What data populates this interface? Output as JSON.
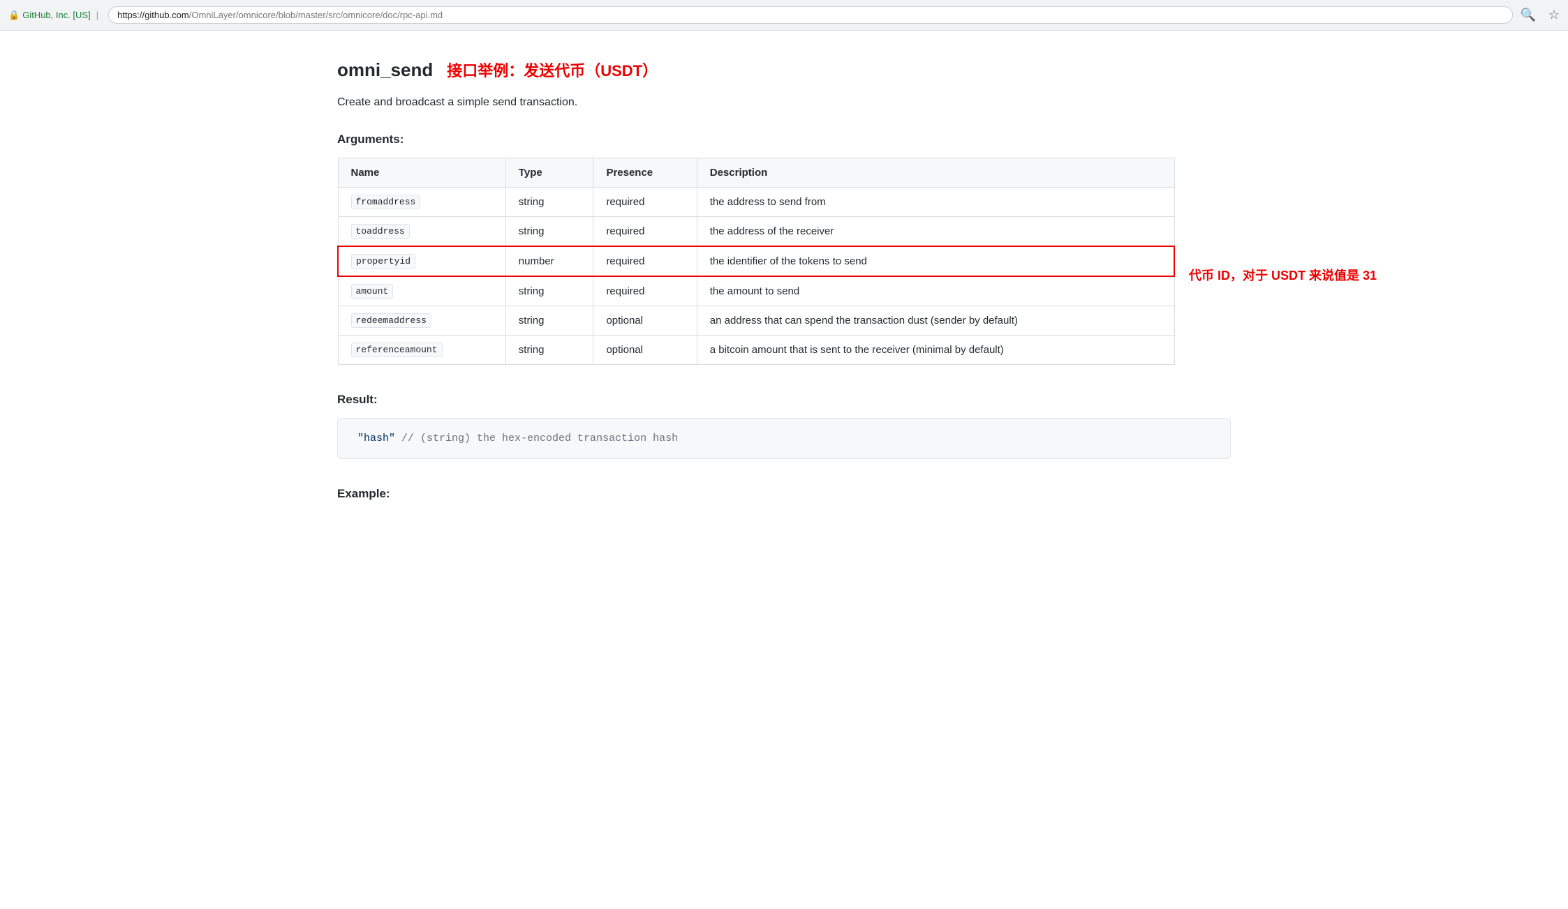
{
  "browser": {
    "security_label": "GitHub, Inc. [US]",
    "url_origin": "https://github.com",
    "url_path": "/OmniLayer/omnicore/blob/master/src/omnicore/doc/rpc-api.md",
    "search_icon": "🔍",
    "star_icon": "☆"
  },
  "page": {
    "title": "omni_send",
    "title_annotation": "接口举例：发送代币（USDT）",
    "description": "Create and broadcast a simple send transaction.",
    "arguments_heading": "Arguments:",
    "table": {
      "headers": [
        "Name",
        "Type",
        "Presence",
        "Description"
      ],
      "rows": [
        {
          "name": "fromaddress",
          "type": "string",
          "presence": "required",
          "description": "the address to send from",
          "highlighted": false
        },
        {
          "name": "toaddress",
          "type": "string",
          "presence": "required",
          "description": "the address of the receiver",
          "highlighted": false
        },
        {
          "name": "propertyid",
          "type": "number",
          "presence": "required",
          "description": "the identifier of the tokens to send",
          "highlighted": true,
          "annotation": "代币 ID，对于 USDT 来说值是 31"
        },
        {
          "name": "amount",
          "type": "string",
          "presence": "required",
          "description": "the amount to send",
          "highlighted": false
        },
        {
          "name": "redeemaddress",
          "type": "string",
          "presence": "optional",
          "description": "an address that can spend the transaction dust (sender by default)",
          "highlighted": false
        },
        {
          "name": "referenceamount",
          "type": "string",
          "presence": "optional",
          "description": "a bitcoin amount that is sent to the receiver (minimal by default)",
          "highlighted": false
        }
      ]
    },
    "result_heading": "Result:",
    "result_code_string": "\"hash\"",
    "result_code_comment": "  // (string) the hex-encoded transaction hash",
    "example_heading": "Example:"
  }
}
